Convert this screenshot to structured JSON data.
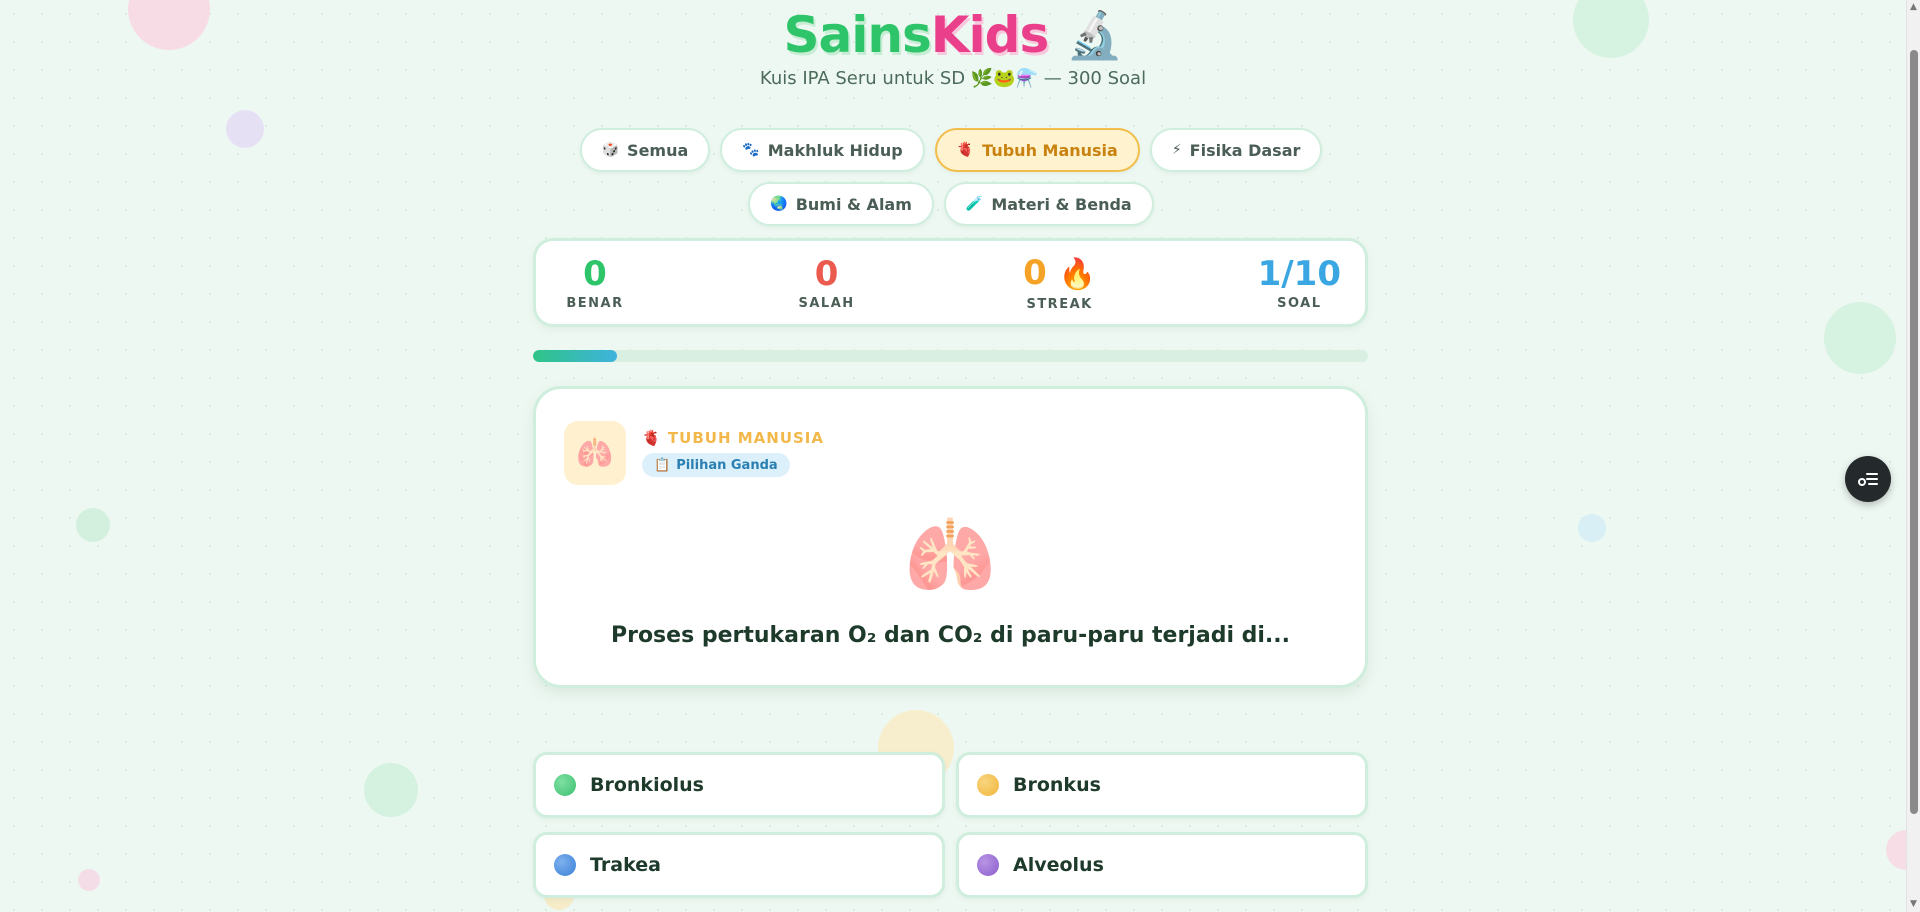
{
  "app": {
    "logo_part1": "Sains",
    "logo_part2": "Kids",
    "logo_icon": "🔬",
    "subtitle": "Kuis IPA Seru untuk SD 🌿🐸⚗️ — 300 Soal"
  },
  "tabs": [
    {
      "icon": "🎲",
      "label": "Semua",
      "active": false
    },
    {
      "icon": "🐾",
      "label": "Makhluk Hidup",
      "active": false
    },
    {
      "icon": "🫀",
      "label": "Tubuh Manusia",
      "active": true
    },
    {
      "icon": "⚡",
      "label": "Fisika Dasar",
      "active": false
    },
    {
      "icon": "🌏",
      "label": "Bumi & Alam",
      "active": false
    },
    {
      "icon": "🧪",
      "label": "Materi & Benda",
      "active": false
    }
  ],
  "stats": {
    "correct": {
      "value": "0",
      "label": "BENAR"
    },
    "wrong": {
      "value": "0",
      "label": "SALAH"
    },
    "streak": {
      "value": "0",
      "icon": "🔥",
      "label": "STREAK"
    },
    "question": {
      "value": "1/10",
      "label": "SOAL"
    }
  },
  "progress": {
    "fraction": 0.1
  },
  "question": {
    "icon": "🫁",
    "category_icon": "🫀",
    "category": "TUBUH MANUSIA",
    "type_icon": "📋",
    "type": "Pilihan Ganda",
    "image": "🫁",
    "text": "Proses pertukaran O₂ dan CO₂ di paru-paru terjadi di..."
  },
  "answers": [
    {
      "label": "Bronkiolus",
      "color": "#3cbf6e"
    },
    {
      "label": "Bronkus",
      "color": "#f1b53a"
    },
    {
      "label": "Trakea",
      "color": "#3a7fd6"
    },
    {
      "label": "Alveolus",
      "color": "#8a5ccc"
    }
  ],
  "colors": {
    "background": "#eef8f2",
    "accent_green": "#2ec46a",
    "accent_pink": "#ea3f8a",
    "active_tab": "#f2bd4a"
  },
  "floating_button": {
    "icon": "checklist-icon"
  }
}
